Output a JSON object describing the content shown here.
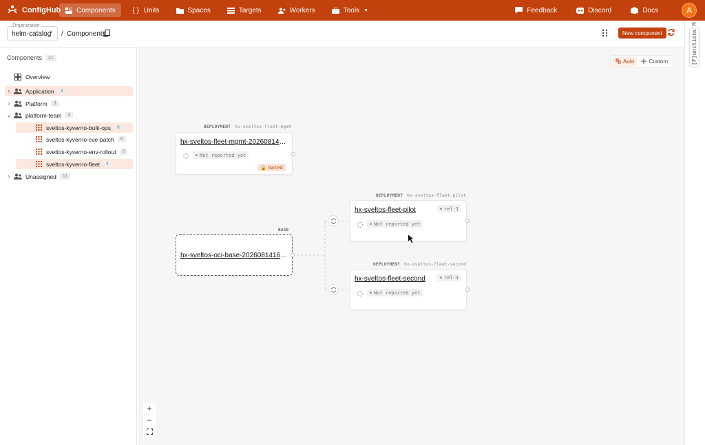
{
  "nav": {
    "brand": "ConfigHub",
    "items": [
      {
        "label": "Components",
        "icon": "components-icon",
        "active": true
      },
      {
        "label": "Units",
        "icon": "braces-icon",
        "active": false
      },
      {
        "label": "Spaces",
        "icon": "folder-icon",
        "active": false
      },
      {
        "label": "Targets",
        "icon": "list-icon",
        "active": false
      },
      {
        "label": "Workers",
        "icon": "workers-icon",
        "active": false
      },
      {
        "label": "Tools",
        "icon": "tools-icon",
        "active": false
      }
    ],
    "feedback": "Feedback",
    "discord": "Discord",
    "docs": "Docs",
    "avatar": "A"
  },
  "header": {
    "org_label": "Organization",
    "org_value": "helm-catalog",
    "breadcrumb_sep": "/",
    "breadcrumb": "Components",
    "new_button": "New component"
  },
  "sidebar": {
    "title": "Components",
    "count": "21",
    "overview": "Overview",
    "groups": [
      {
        "label": "Application",
        "count": "3",
        "expanded": false
      },
      {
        "label": "Platform",
        "count": "3",
        "expanded": false
      },
      {
        "label": "platform-team",
        "count": "4",
        "expanded": true
      },
      {
        "label": "Unassigned",
        "count": "11",
        "expanded": false
      }
    ],
    "children": [
      {
        "label": "sveltos-kyverno-bulk-ops",
        "count": "6"
      },
      {
        "label": "sveltos-kyverno-cve-patch",
        "count": "6"
      },
      {
        "label": "sveltos-kyverno-env-rollout",
        "count": "6"
      },
      {
        "label": "sveltos-kyverno-fleet",
        "count": "4"
      }
    ]
  },
  "canvas": {
    "mode_auto": "Auto",
    "mode_custom": "Custom",
    "nodes": {
      "mgmt": {
        "kind": "DEPLOYMENT",
        "space": "hx-sveltos-fleet-mgmt",
        "title": "hx-sveltos-fleet-mgmt-20260814164…",
        "status": "Not reported yet",
        "gate": "Gated"
      },
      "base": {
        "kind": "BASE",
        "title": "hx-sveltos-oci-base-20260814164…"
      },
      "pilot": {
        "kind": "DEPLOYMENT",
        "space": "hx-sveltos-fleet-pilot",
        "title": "hx-sveltos-fleet-pilot",
        "status": "Not reported yet",
        "release": "rel-1"
      },
      "second": {
        "kind": "DEPLOYMENT",
        "space": "hx-sveltos-fleet-second",
        "title": "hx-sveltos-fleet-second",
        "status": "Not reported yet",
        "release": "rel-1"
      }
    },
    "zoom_in": "+",
    "zoom_out": "−"
  },
  "rail": {
    "label": "[F]unctions M"
  },
  "colors": {
    "accent": "#c2410c",
    "selected_bg": "#fde8df",
    "canvas_bg": "#f6f6f7"
  }
}
